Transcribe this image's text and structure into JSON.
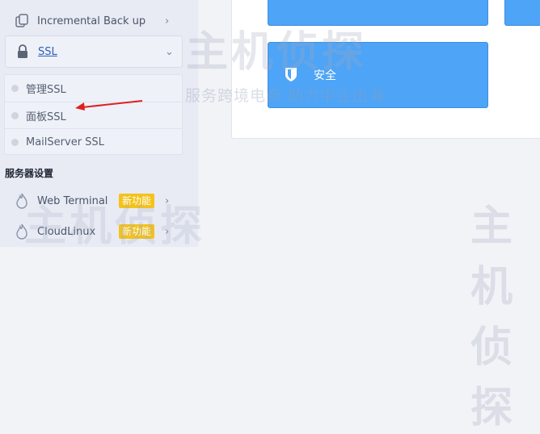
{
  "sidebar": {
    "backup_label": "Incremental Back up",
    "ssl_label": "SSL",
    "ssl_submenu": [
      {
        "label": "管理SSL"
      },
      {
        "label": "面板SSL"
      },
      {
        "label": "MailServer SSL"
      }
    ],
    "server_section_title": "服务器设置",
    "web_terminal_label": "Web Terminal",
    "cloudlinux_label": "CloudLinux",
    "new_badge": "新功能"
  },
  "main": {
    "security_tile_label": "安全"
  },
  "watermark": {
    "title": "主机侦探",
    "slogan": "服务跨境电商 助力中企出海"
  },
  "colors": {
    "tile_blue": "#4ea4f6",
    "badge_yellow": "#f4c21b",
    "arrow_red": "#e02020"
  }
}
